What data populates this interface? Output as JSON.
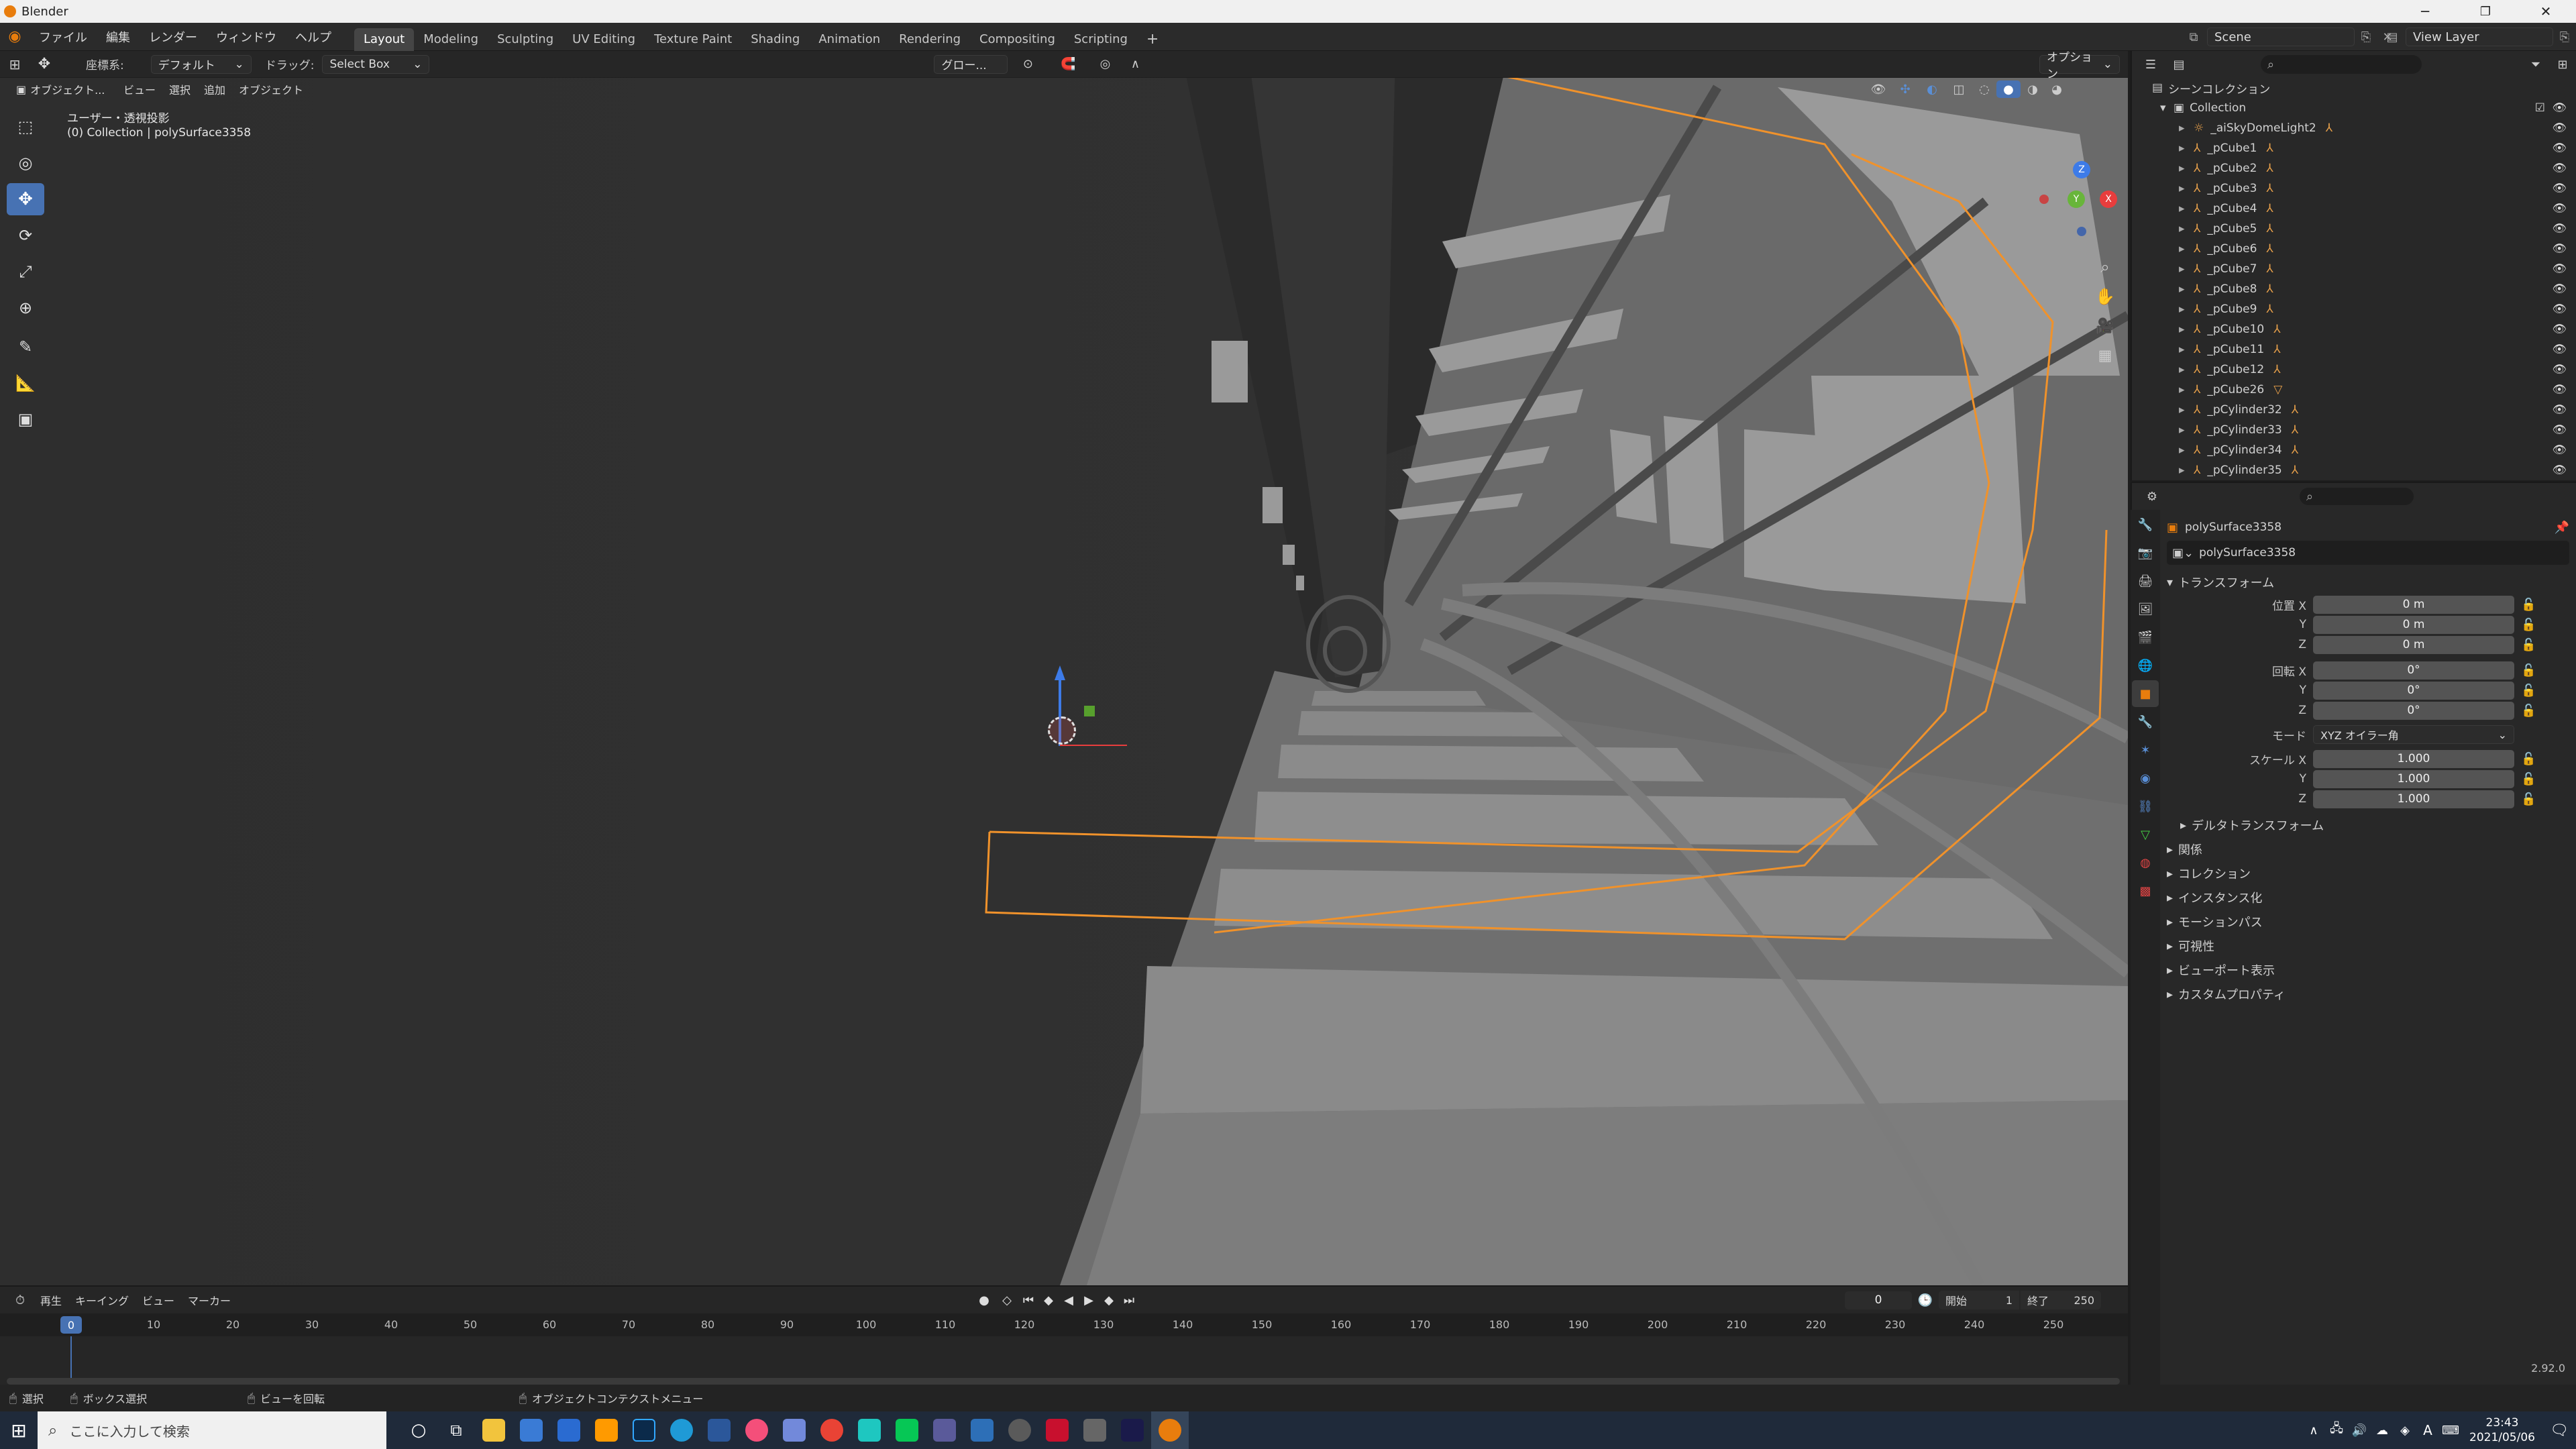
{
  "window": {
    "title": "Blender"
  },
  "menubar": {
    "menus": [
      "ファイル",
      "編集",
      "レンダー",
      "ウィンドウ",
      "ヘルプ"
    ],
    "workspaces": [
      "Layout",
      "Modeling",
      "Sculpting",
      "UV Editing",
      "Texture Paint",
      "Shading",
      "Animation",
      "Rendering",
      "Compositing",
      "Scripting"
    ],
    "active_workspace": "Layout",
    "scene": "Scene",
    "view_layer": "View Layer"
  },
  "viewport_header": {
    "orientation_label": "座標系:",
    "orientation_value": "デフォルト",
    "drag_label": "ドラッグ:",
    "drag_value": "Select Box",
    "transform_space": "グロー...",
    "options": "オプション"
  },
  "viewport_header2": {
    "mode": "オブジェクト...",
    "menus": [
      "ビュー",
      "選択",
      "追加",
      "オブジェクト"
    ]
  },
  "viewport_overlay": {
    "view_name": "ユーザー・透視投影",
    "object_info": "(0) Collection | polySurface3358"
  },
  "gizmo": {
    "z": "Z",
    "y": "Y",
    "x": "X"
  },
  "outliner": {
    "title": "シーンコレクション",
    "collection": "Collection",
    "items": [
      "_aiSkyDomeLight2",
      "_pCube1",
      "_pCube2",
      "_pCube3",
      "_pCube4",
      "_pCube5",
      "_pCube6",
      "_pCube7",
      "_pCube8",
      "_pCube9",
      "_pCube10",
      "_pCube11",
      "_pCube12",
      "_pCube26",
      "_pCylinder32",
      "_pCylinder33",
      "_pCylinder34",
      "_pCylinder35"
    ]
  },
  "properties": {
    "object_name": "polySurface3358",
    "data_name": "polySurface3358",
    "transform_title": "トランスフォーム",
    "location_label": "位置 X",
    "location": [
      "0 m",
      "0 m",
      "0 m"
    ],
    "rotation_label": "回転 X",
    "rotation": [
      "0°",
      "0°",
      "0°"
    ],
    "axis_y": "Y",
    "axis_z": "Z",
    "mode_label": "モード",
    "mode_value": "XYZ オイラー角",
    "scale_label": "スケール X",
    "scale": [
      "1.000",
      "1.000",
      "1.000"
    ],
    "delta": "デルタトランスフォーム",
    "sections": [
      "関係",
      "コレクション",
      "インスタンス化",
      "モーションパス",
      "可視性",
      "ビューポート表示",
      "カスタムプロパティ"
    ]
  },
  "timeline": {
    "menus": [
      "再生",
      "キーイング",
      "ビュー",
      "マーカー"
    ],
    "current_frame": "0",
    "start_label": "開始",
    "start": "1",
    "end_label": "終了",
    "end": "250",
    "ticks": [
      "0",
      "10",
      "20",
      "30",
      "40",
      "50",
      "60",
      "70",
      "80",
      "90",
      "100",
      "110",
      "120",
      "130",
      "140",
      "150",
      "160",
      "170",
      "180",
      "190",
      "200",
      "210",
      "220",
      "230",
      "240",
      "250"
    ]
  },
  "statusbar": {
    "select": "選択",
    "box_select": "ボックス選択",
    "rotate_view": "ビューを回転",
    "context_menu": "オブジェクトコンテクストメニュー",
    "version": "2.92.0"
  },
  "taskbar": {
    "search_placeholder": "ここに入力して検索",
    "time": "23:43",
    "date": "2021/05/06",
    "ime": "A"
  }
}
